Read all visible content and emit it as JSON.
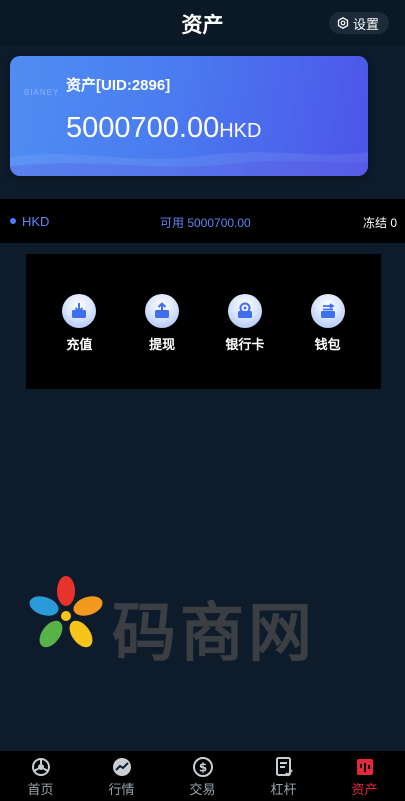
{
  "header": {
    "title": "资产",
    "settings_label": "设置"
  },
  "card": {
    "watermark": "BIANEY",
    "uid_label": "资产[UID:2896]",
    "amount": "5000700.00",
    "currency": "HKD"
  },
  "balance_row": {
    "currency": "HKD",
    "available": "可用 5000700.00",
    "frozen": "冻结 0"
  },
  "actions": [
    {
      "label": "充值",
      "icon": "deposit-icon"
    },
    {
      "label": "提现",
      "icon": "withdraw-icon"
    },
    {
      "label": "银行卡",
      "icon": "bank-card-icon"
    },
    {
      "label": "钱包",
      "icon": "wallet-icon"
    }
  ],
  "watermark_logo": {
    "text": "码商网"
  },
  "tabbar": {
    "items": [
      {
        "label": "首页",
        "icon": "home-icon"
      },
      {
        "label": "行情",
        "icon": "market-icon"
      },
      {
        "label": "交易",
        "icon": "trade-icon"
      },
      {
        "label": "杠杆",
        "icon": "leverage-icon"
      },
      {
        "label": "资产",
        "icon": "assets-icon",
        "active": true
      }
    ]
  },
  "colors": {
    "background": "#0d1b2a",
    "accent": "#5c86f5",
    "active_tab": "#e2283a"
  }
}
